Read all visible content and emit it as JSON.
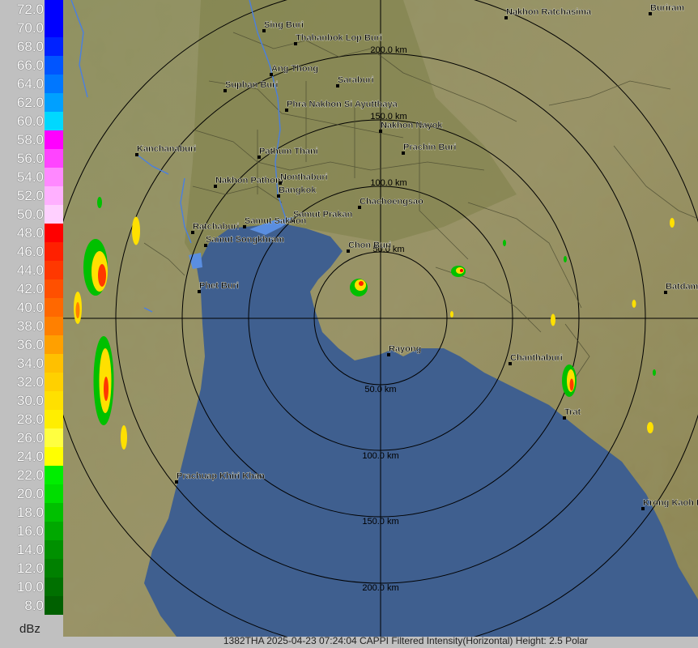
{
  "legend": {
    "unit": "dBz",
    "levels": [
      {
        "label": "72.0",
        "color": "#0000ff"
      },
      {
        "label": "70.0",
        "color": "#0000ff"
      },
      {
        "label": "68.0",
        "color": "#0022ff"
      },
      {
        "label": "66.0",
        "color": "#0055ff"
      },
      {
        "label": "64.0",
        "color": "#0077ff"
      },
      {
        "label": "62.0",
        "color": "#00a0ff"
      },
      {
        "label": "60.0",
        "color": "#00d8ff"
      },
      {
        "label": "58.0",
        "color": "#ff00ff"
      },
      {
        "label": "56.0",
        "color": "#ff44ff"
      },
      {
        "label": "54.0",
        "color": "#ff88ff"
      },
      {
        "label": "52.0",
        "color": "#ffb0ff"
      },
      {
        "label": "50.0",
        "color": "#ffd0ff"
      },
      {
        "label": "48.0",
        "color": "#ff0000"
      },
      {
        "label": "46.0",
        "color": "#ff2000"
      },
      {
        "label": "44.0",
        "color": "#ff3800"
      },
      {
        "label": "42.0",
        "color": "#ff5000"
      },
      {
        "label": "40.0",
        "color": "#ff6800"
      },
      {
        "label": "38.0",
        "color": "#ff8000"
      },
      {
        "label": "36.0",
        "color": "#ffa000"
      },
      {
        "label": "34.0",
        "color": "#ffc000"
      },
      {
        "label": "32.0",
        "color": "#ffd000"
      },
      {
        "label": "30.0",
        "color": "#ffe000"
      },
      {
        "label": "28.0",
        "color": "#ffee00"
      },
      {
        "label": "26.0",
        "color": "#ffff40"
      },
      {
        "label": "24.0",
        "color": "#ffff00"
      },
      {
        "label": "22.0",
        "color": "#00ee00"
      },
      {
        "label": "20.0",
        "color": "#00dd00"
      },
      {
        "label": "18.0",
        "color": "#00c000"
      },
      {
        "label": "16.0",
        "color": "#00a800"
      },
      {
        "label": "14.0",
        "color": "#009000"
      },
      {
        "label": "12.0",
        "color": "#008000"
      },
      {
        "label": "10.0",
        "color": "#007000"
      },
      {
        "label": "8.0",
        "color": "#006000"
      }
    ]
  },
  "rings": [
    {
      "label": "50.0 km"
    },
    {
      "label": "100.0 km"
    },
    {
      "label": "150.0 km"
    },
    {
      "label": "200.0 km"
    }
  ],
  "rings_north": [
    {
      "label": "50.0 km"
    },
    {
      "label": "100.0 km"
    },
    {
      "label": "150.0 km"
    },
    {
      "label": "200.0 km"
    }
  ],
  "cities": [
    {
      "name": "Sing Buri"
    },
    {
      "name": "Thahanbok Lop Buri"
    },
    {
      "name": "Nakhon Ratchasima"
    },
    {
      "name": "Buriram"
    },
    {
      "name": "Ang Thong"
    },
    {
      "name": "Saraburi"
    },
    {
      "name": "Suphan Buri"
    },
    {
      "name": "Phra Nakhon Si Ayutthaya"
    },
    {
      "name": "Nakhon Nayok"
    },
    {
      "name": "Kanchanaburi"
    },
    {
      "name": "Pathum Thani"
    },
    {
      "name": "Prachin Buri"
    },
    {
      "name": "Nakhon Pathom"
    },
    {
      "name": "Nonthaburi"
    },
    {
      "name": "Bangkok"
    },
    {
      "name": "Chachoengsao"
    },
    {
      "name": "Samut Prakan"
    },
    {
      "name": "Samut Sakhon"
    },
    {
      "name": "Ratchaburi"
    },
    {
      "name": "Samut Songkhram"
    },
    {
      "name": "Chon Buri"
    },
    {
      "name": "Phet Buri"
    },
    {
      "name": "Batdamb"
    },
    {
      "name": "Rayong"
    },
    {
      "name": "Chanthaburi"
    },
    {
      "name": "Trat"
    },
    {
      "name": "Prachuap Khiri Khan"
    },
    {
      "name": "Krong Kaoh Ko"
    }
  ],
  "status": "1382THA 2025-04-23 07:24:04 CAPPI Filtered Intensity(Horizontal)  Height: 2.5 Polar",
  "colors": {
    "sea": "#3f5f8f",
    "land": "#8a8a4a",
    "background": "#c0c0c0"
  }
}
